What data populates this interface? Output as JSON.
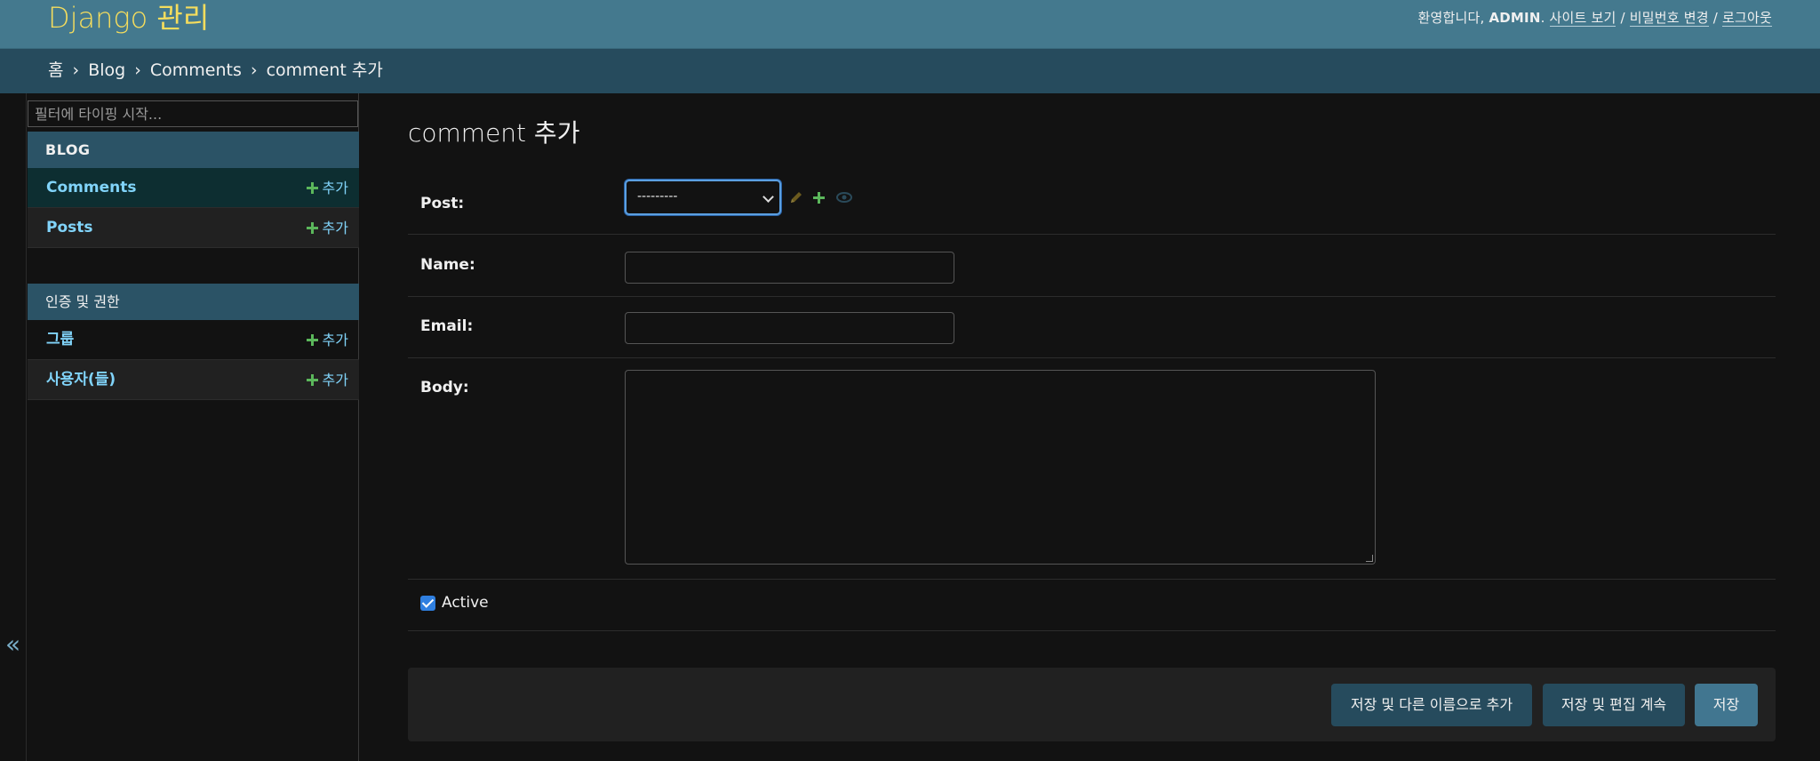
{
  "header": {
    "brand": "Django 관리",
    "welcome": "환영합니다,",
    "username": "ADMIN",
    "view_site": "사이트 보기",
    "change_password": "비밀번호 변경",
    "logout": "로그아웃",
    "separator": "/"
  },
  "breadcrumbs": {
    "home": "홈",
    "app": "Blog",
    "model": "Comments",
    "current": "comment 추가",
    "arrow": "›"
  },
  "sidebar": {
    "toggle": "«",
    "filter_placeholder": "필터에 타이핑 시작...",
    "apps": [
      {
        "caption": "BLOG",
        "models": [
          {
            "name": "Comments",
            "add": "추가"
          },
          {
            "name": "Posts",
            "add": "추가"
          }
        ]
      },
      {
        "caption": "인증 및 권한",
        "models": [
          {
            "name": "그룹",
            "add": "추가"
          },
          {
            "name": "사용자(들)",
            "add": "추가"
          }
        ]
      }
    ]
  },
  "form": {
    "title": "comment 추가",
    "post_label": "Post:",
    "post_value": "---------",
    "name_label": "Name:",
    "email_label": "Email:",
    "body_label": "Body:",
    "active_label": "Active",
    "active_checked": true
  },
  "buttons": {
    "save_as_new": "저장 및 다른 이름으로 추가",
    "save_continue": "저장 및 편집 계속",
    "save": "저장"
  },
  "icons": {
    "change": "pencil-icon",
    "add": "plus-icon",
    "view": "eye-icon"
  },
  "colors": {
    "header_bg": "#44798e",
    "brand": "#f5dd5d",
    "breadcrumbs_bg": "#264b5d",
    "link": "#81d4fa",
    "add_plus": "#5bb75b"
  }
}
